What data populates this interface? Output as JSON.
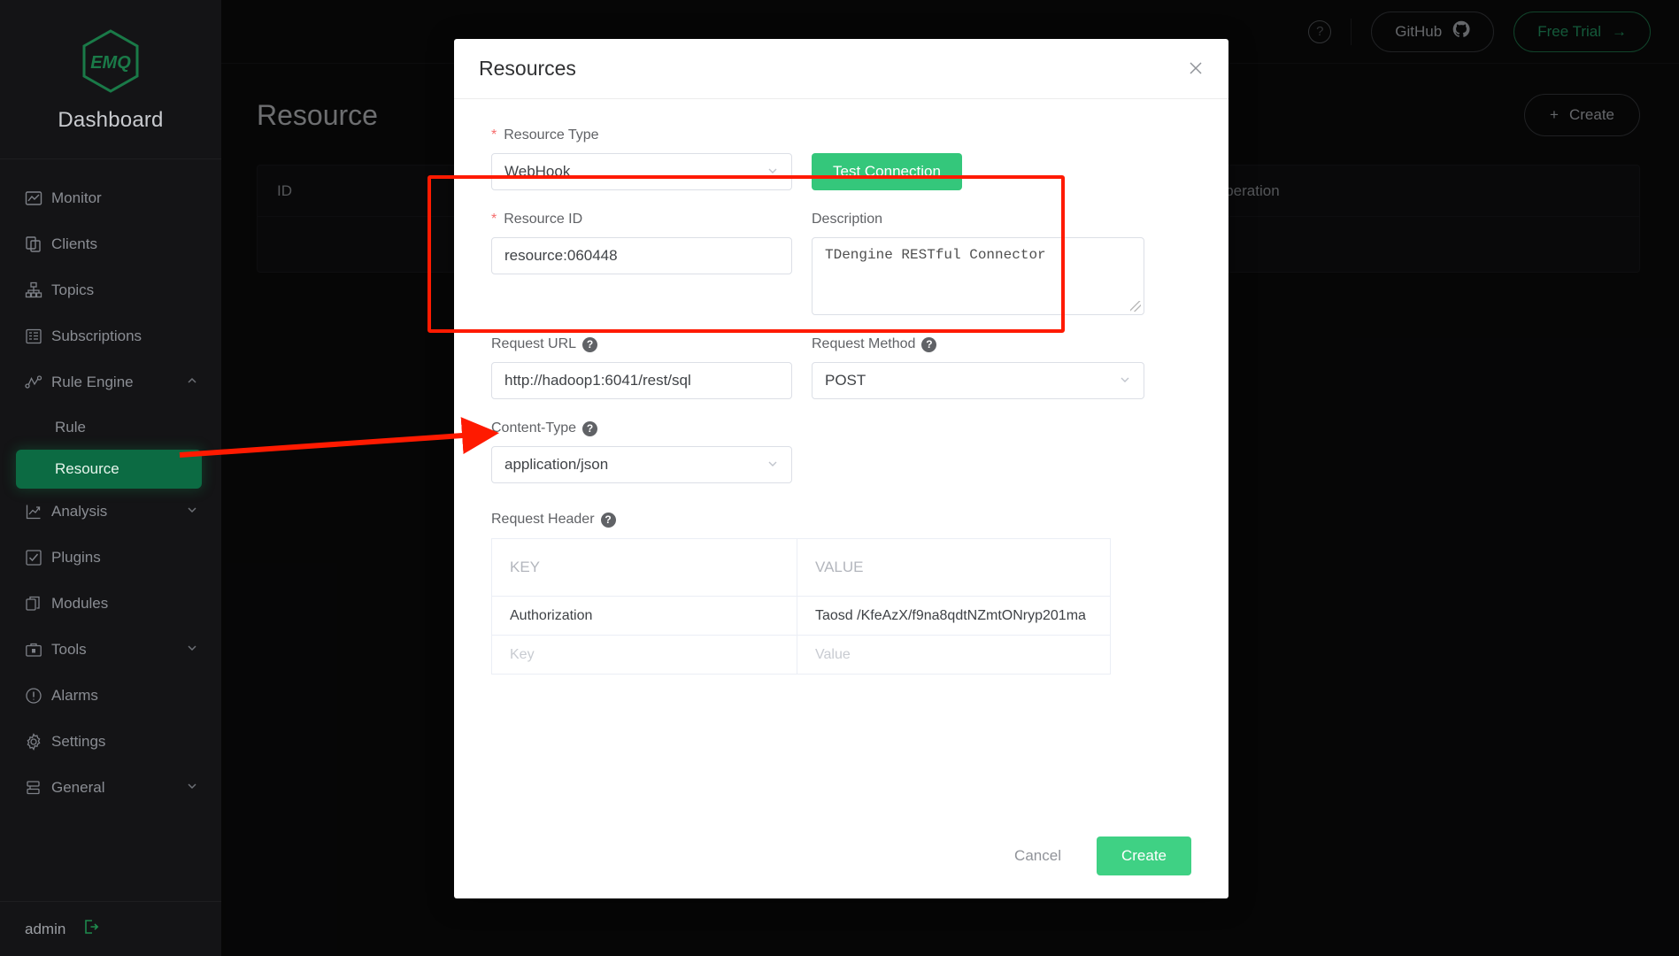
{
  "sidebar": {
    "brand": {
      "logo_text": "EMQ",
      "name": "Dashboard"
    },
    "items": [
      {
        "label": "Monitor",
        "icon": "monitor-icon",
        "caret": ""
      },
      {
        "label": "Clients",
        "icon": "clients-icon",
        "caret": ""
      },
      {
        "label": "Topics",
        "icon": "topics-icon",
        "caret": ""
      },
      {
        "label": "Subscriptions",
        "icon": "subscriptions-icon",
        "caret": ""
      },
      {
        "label": "Rule Engine",
        "icon": "rule-engine-icon",
        "caret": "chevron-up"
      },
      {
        "label": "Analysis",
        "icon": "analysis-icon",
        "caret": "chevron-down"
      },
      {
        "label": "Plugins",
        "icon": "plugins-icon",
        "caret": ""
      },
      {
        "label": "Modules",
        "icon": "modules-icon",
        "caret": ""
      },
      {
        "label": "Tools",
        "icon": "tools-icon",
        "caret": "chevron-down"
      },
      {
        "label": "Alarms",
        "icon": "alarms-icon",
        "caret": ""
      },
      {
        "label": "Settings",
        "icon": "gear-icon",
        "caret": ""
      },
      {
        "label": "General",
        "icon": "general-icon",
        "caret": "chevron-down"
      }
    ],
    "sub_items": [
      {
        "label": "Rule",
        "active": false
      },
      {
        "label": "Resource",
        "active": true
      }
    ],
    "user": {
      "name": "admin",
      "logout_icon": "logout-icon"
    }
  },
  "topbar": {
    "help_label": "?",
    "github_label": "GitHub",
    "free_trial_label": "Free Trial",
    "free_trial_arrow": "→"
  },
  "page": {
    "title": "Resource",
    "create_button": "Create",
    "create_plus": "+",
    "table": {
      "columns": [
        "ID",
        "Operation"
      ],
      "rows": []
    }
  },
  "modal": {
    "title": "Resources",
    "close_icon": "close-icon",
    "fields": {
      "resource_type": {
        "label": "Resource Type",
        "required": true,
        "value": "WebHook",
        "type": "select"
      },
      "test_connection_button": "Test Connection",
      "resource_id": {
        "label": "Resource ID",
        "required": true,
        "value": "resource:060448",
        "type": "input"
      },
      "description": {
        "label": "Description",
        "required": false,
        "value": "TDengine RESTful Connector",
        "type": "textarea"
      },
      "request_url": {
        "label": "Request URL",
        "required": false,
        "help": "?",
        "value": "http://hadoop1:6041/rest/sql",
        "type": "input"
      },
      "request_method": {
        "label": "Request Method",
        "required": false,
        "help": "?",
        "value": "POST",
        "type": "select"
      },
      "content_type": {
        "label": "Content-Type",
        "required": false,
        "help": "?",
        "value": "application/json",
        "type": "select"
      },
      "request_header": {
        "label": "Request Header",
        "help": "?",
        "columns": [
          "KEY",
          "VALUE"
        ],
        "rows": [
          {
            "key": "Authorization",
            "value": "Taosd /KfeAzX/f9na8qdtNZmtONryp201ma",
            "placeholder": false
          }
        ],
        "new_row": {
          "key_placeholder": "Key",
          "value_placeholder": "Value"
        }
      }
    },
    "footer": {
      "cancel_label": "Cancel",
      "create_label": "Create"
    }
  },
  "annotations": {
    "highlight_color": "#ff1a00",
    "arrow_color": "#ff1a00",
    "arrow_target": "request-header-section",
    "arrow_origin": "sidebar-item-resource"
  },
  "colors": {
    "accent_green": "#34c77b",
    "sidebar_bg": "#141416",
    "active_nav": "#0c6b43",
    "brand_green": "#1a7a48"
  }
}
